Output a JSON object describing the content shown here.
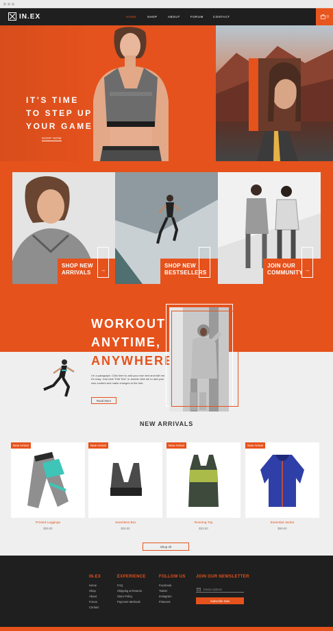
{
  "brand": {
    "name": "IN.EX",
    "accent": "#e6521c",
    "dark": "#1f1f1f"
  },
  "nav": {
    "items": [
      {
        "label": "HOME",
        "active": true
      },
      {
        "label": "SHOP"
      },
      {
        "label": "ABOUT"
      },
      {
        "label": "FORUM"
      },
      {
        "label": "CONTACT"
      }
    ],
    "cart_label": "0"
  },
  "hero": {
    "title_lines": [
      "IT'S TIME",
      "TO STEP UP",
      "YOUR GAME"
    ],
    "cta": "SHOP NOW"
  },
  "tiles": [
    {
      "line1": "SHOP NEW",
      "line2": "ARRIVALS"
    },
    {
      "line1": "SHOP NEW",
      "line2": "BESTSELLERS"
    },
    {
      "line1": "JOIN OUR",
      "line2": "COMMUNITY"
    }
  ],
  "workout": {
    "line1": "WORKOUT",
    "line2": "ANYTIME,",
    "line3": "ANYWHERE",
    "paragraph": "I'm a paragraph. Click here to add your own text and edit me. It's easy. Just click \"Edit Text\" or double click me to add your own content and make changes to the font.",
    "button": "Read More"
  },
  "new_arrivals": {
    "title": "NEW ARRIVALS",
    "badge": "New Arrival",
    "products": [
      {
        "name": "Printed Leggings",
        "price": "$35.00"
      },
      {
        "name": "Seamless Bra",
        "price": "$25.00"
      },
      {
        "name": "Running Top",
        "price": "$33.00"
      },
      {
        "name": "Essential Jacket",
        "price": "$59.00"
      }
    ],
    "shop_all": "Shop All"
  },
  "footer": {
    "col1": {
      "head": "IN.EX",
      "links": [
        "Home",
        "Shop",
        "About",
        "Forum",
        "Contact"
      ]
    },
    "col2": {
      "head": "EXPERIENCE",
      "links": [
        "FAQ",
        "Shipping & Returns",
        "Store Policy",
        "Payment Methods"
      ]
    },
    "col3": {
      "head": "FOLLOW US",
      "links": [
        "Facebook",
        "Twitter",
        "Instagram",
        "Pinterest"
      ]
    },
    "newsletter": {
      "head": "JOIN OUR NEWSLETTER",
      "email_placeholder": "Email Address",
      "button": "Subscribe Now"
    }
  }
}
